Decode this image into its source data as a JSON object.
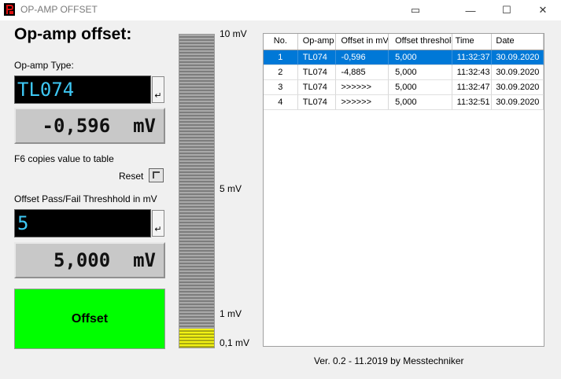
{
  "window": {
    "title": "OP-AMP OFFSET",
    "minimize": "—",
    "maximize": "☐",
    "close": "✕",
    "pip": "▭"
  },
  "heading": "Op-amp offset:",
  "opamp": {
    "label": "Op-amp Type:",
    "value": "TL074",
    "enter": "↵"
  },
  "measurement": {
    "value": "-0,596  mV"
  },
  "hint": "F6 copies value to table",
  "reset_label": "Reset",
  "threshold": {
    "label": "Offset Pass/Fail Threshhold in mV",
    "value": "5",
    "enter": "↵",
    "display": "5,000  mV"
  },
  "status_label": "Offset",
  "scale": {
    "ticks": [
      "10 mV",
      "5 mV",
      "1 mV",
      "0,1 mV"
    ],
    "level": 0.06
  },
  "table": {
    "columns": [
      "No.",
      "Op-amp",
      "Offset in mV",
      "Offset threshold",
      "Time",
      "Date"
    ],
    "rows": [
      [
        "1",
        "TL074",
        "-0,596",
        "5,000",
        "11:32:37",
        "30.09.2020"
      ],
      [
        "2",
        "TL074",
        "-4,885",
        "5,000",
        "11:32:43",
        "30.09.2020"
      ],
      [
        "3",
        "TL074",
        ">>>>>>",
        "5,000",
        "11:32:47",
        "30.09.2020"
      ],
      [
        "4",
        "TL074",
        ">>>>>>",
        "5,000",
        "11:32:51",
        "30.09.2020"
      ]
    ],
    "selected_row": 0
  },
  "version": "Ver. 0.2 - 11.2019 by Messtechniker",
  "colors": {
    "lcd_text": "#3ec8f5",
    "status_pass": "#00ff00",
    "selection": "#0078d7",
    "bar_fill": "#f2f214"
  }
}
